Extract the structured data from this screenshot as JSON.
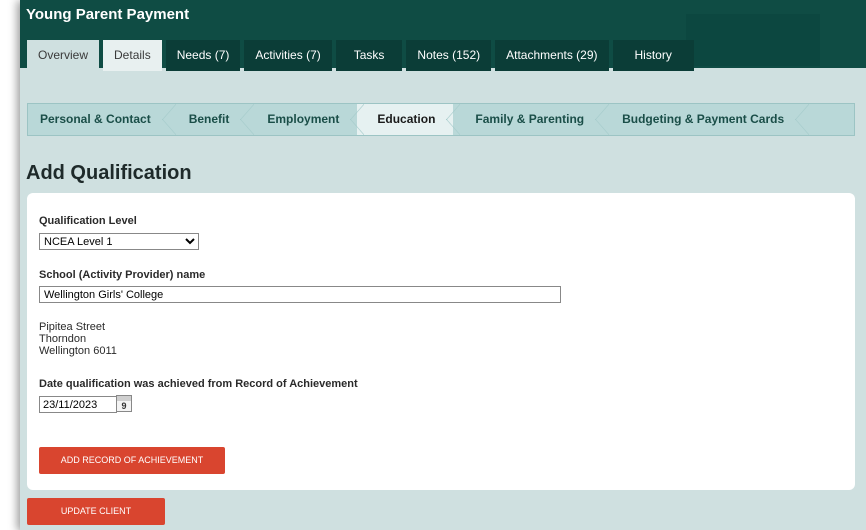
{
  "app": {
    "title": "Young Parent Payment"
  },
  "tabs": [
    {
      "label": "Overview"
    },
    {
      "label": "Details"
    },
    {
      "label": "Needs (7)"
    },
    {
      "label": "Activities (7)"
    },
    {
      "label": "Tasks"
    },
    {
      "label": "Notes (152)"
    },
    {
      "label": "Attachments (29)"
    },
    {
      "label": "History"
    }
  ],
  "subnav": [
    {
      "label": "Personal & Contact"
    },
    {
      "label": "Benefit"
    },
    {
      "label": "Employment"
    },
    {
      "label": "Education"
    },
    {
      "label": "Family & Parenting"
    },
    {
      "label": "Budgeting & Payment Cards"
    }
  ],
  "page": {
    "title": "Add Qualification"
  },
  "form": {
    "qualification_level": {
      "label": "Qualification Level",
      "value": "NCEA Level 1",
      "options": [
        "NCEA Level 1"
      ]
    },
    "school": {
      "label": "School (Activity Provider) name",
      "value": "Wellington Girls' College"
    },
    "address": {
      "line1": "Pipitea Street",
      "line2": "Thorndon",
      "line3": "Wellington 6011"
    },
    "date": {
      "label": "Date qualification was achieved from Record of Achievement",
      "value": "23/11/2023",
      "calendar_day": "9"
    },
    "add_button": "ADD RECORD OF ACHIEVEMENT"
  },
  "footer": {
    "update_button": "UPDATE CLIENT"
  },
  "colors": {
    "header": "#0f4c44",
    "tab_dark": "#0b3d37",
    "background": "#cfe0e0",
    "button": "#d9452f"
  }
}
